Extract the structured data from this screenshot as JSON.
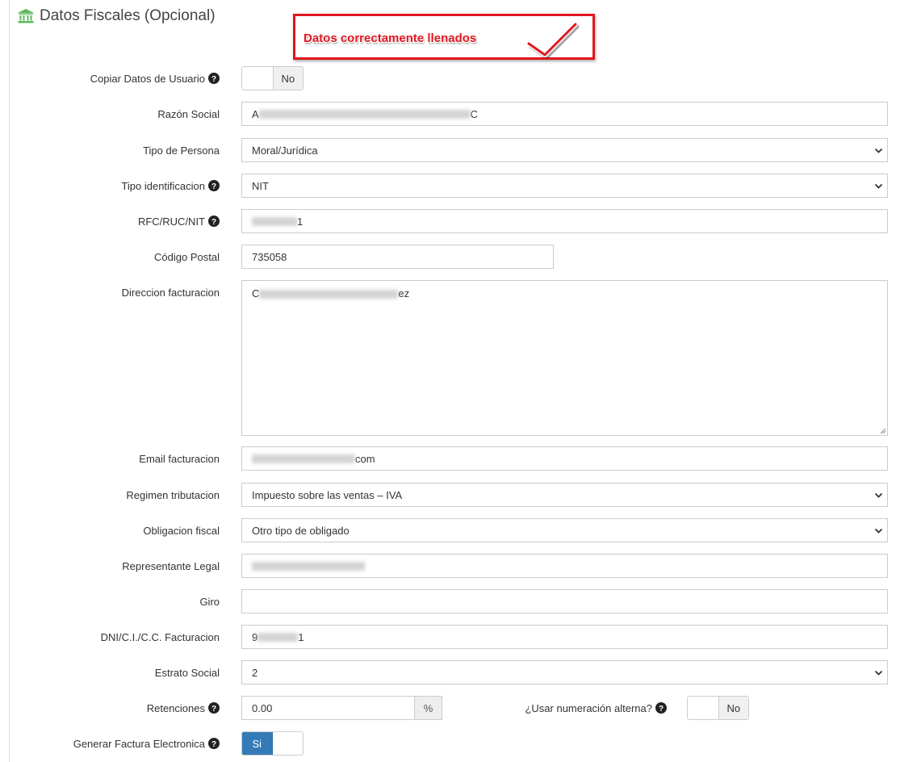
{
  "header": {
    "title": "Datos Fiscales (Opcional)",
    "icon": "bank-icon",
    "icon_color": "#5cb85c"
  },
  "callout": {
    "text": "Datos correctamente llenados",
    "color": "#e3161f"
  },
  "form": {
    "copiar": {
      "label": "Copiar Datos de Usuario",
      "toggle_value": "No"
    },
    "razon_social": {
      "label": "Razón Social",
      "value_start": "A",
      "value_end": "C"
    },
    "tipo_persona": {
      "label": "Tipo de Persona",
      "selected": "Moral/Jurídica"
    },
    "tipo_identificacion": {
      "label": "Tipo identificacion",
      "selected": "NIT"
    },
    "rfc": {
      "label": "RFC/RUC/NIT",
      "value_end": "1"
    },
    "codigo_postal": {
      "label": "Código Postal",
      "value": "735058"
    },
    "direccion": {
      "label": "Direccion facturacion",
      "value_start": "C",
      "value_end": "ez"
    },
    "email": {
      "label": "Email facturacion",
      "value_end": "com"
    },
    "regimen": {
      "label": "Regimen tributacion",
      "selected": "Impuesto sobre las ventas – IVA"
    },
    "obligacion": {
      "label": "Obligacion fiscal",
      "selected": "Otro tipo de obligado"
    },
    "representante": {
      "label": "Representante Legal"
    },
    "giro": {
      "label": "Giro",
      "value": ""
    },
    "dni": {
      "label": "DNI/C.I./C.C. Facturacion",
      "value_start": "9",
      "value_end": "1"
    },
    "estrato": {
      "label": "Estrato Social",
      "selected": "2"
    },
    "retenciones": {
      "label": "Retenciones",
      "value": "0.00",
      "addon": "%"
    },
    "numeracion": {
      "label": "¿Usar numeración alterna?",
      "toggle_value": "No"
    },
    "factura": {
      "label": "Generar Factura Electronica",
      "toggle_value": "Si"
    }
  },
  "colors": {
    "primary": "#337ab7",
    "border": "#cccccc"
  }
}
